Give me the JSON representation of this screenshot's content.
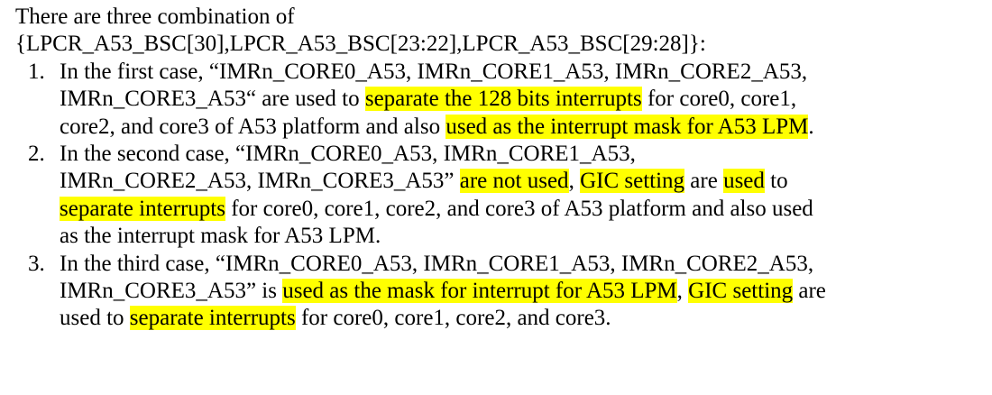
{
  "intro": {
    "line1": "There are three combination of",
    "line2": "{LPCR_A53_BSC[30],LPCR_A53_BSC[23:22],LPCR_A53_BSC[29:28]}:"
  },
  "items": [
    {
      "number": "1.",
      "l1": "In the first case, “IMRn_CORE0_A53, IMRn_CORE1_A53, IMRn_CORE2_A53,",
      "l2a": "IMRn_CORE3_A53“ are used to ",
      "l2h": "separate the 128 bits interrupts",
      "l2b": " for core0, core1,",
      "l3a": "core2, and core3 of A53 platform and also ",
      "l3h": "used as the interrupt mask for A53 LPM",
      "l3b": "."
    },
    {
      "number": "2.",
      "l1": "In the second case, “IMRn_CORE0_A53, IMRn_CORE1_A53,",
      "l2a": "IMRn_CORE2_A53, IMRn_CORE3_A53” ",
      "l2h1": "are not used",
      "l2b": ", ",
      "l2h2": "GIC setting",
      "l2c": " are ",
      "l2h3": "used",
      "l2d": " to",
      "l3h": "separate interrupts",
      "l3a": " for core0, core1, core2, and core3 of A53 platform and also used",
      "l4": "as the interrupt mask for A53 LPM."
    },
    {
      "number": "3.",
      "l1": "In the third case, “IMRn_CORE0_A53, IMRn_CORE1_A53, IMRn_CORE2_A53,",
      "l2a": "IMRn_CORE3_A53” is ",
      "l2h1": "used as the mask for interrupt for A53 LPM",
      "l2b": ", ",
      "l2h2": "GIC setting",
      "l2c": " are",
      "l3a": "used to ",
      "l3h": "separate interrupts",
      "l3b": " for core0, core1, core2, and core3."
    }
  ],
  "colors": {
    "highlight": "#ffff00",
    "text": "#000000"
  }
}
